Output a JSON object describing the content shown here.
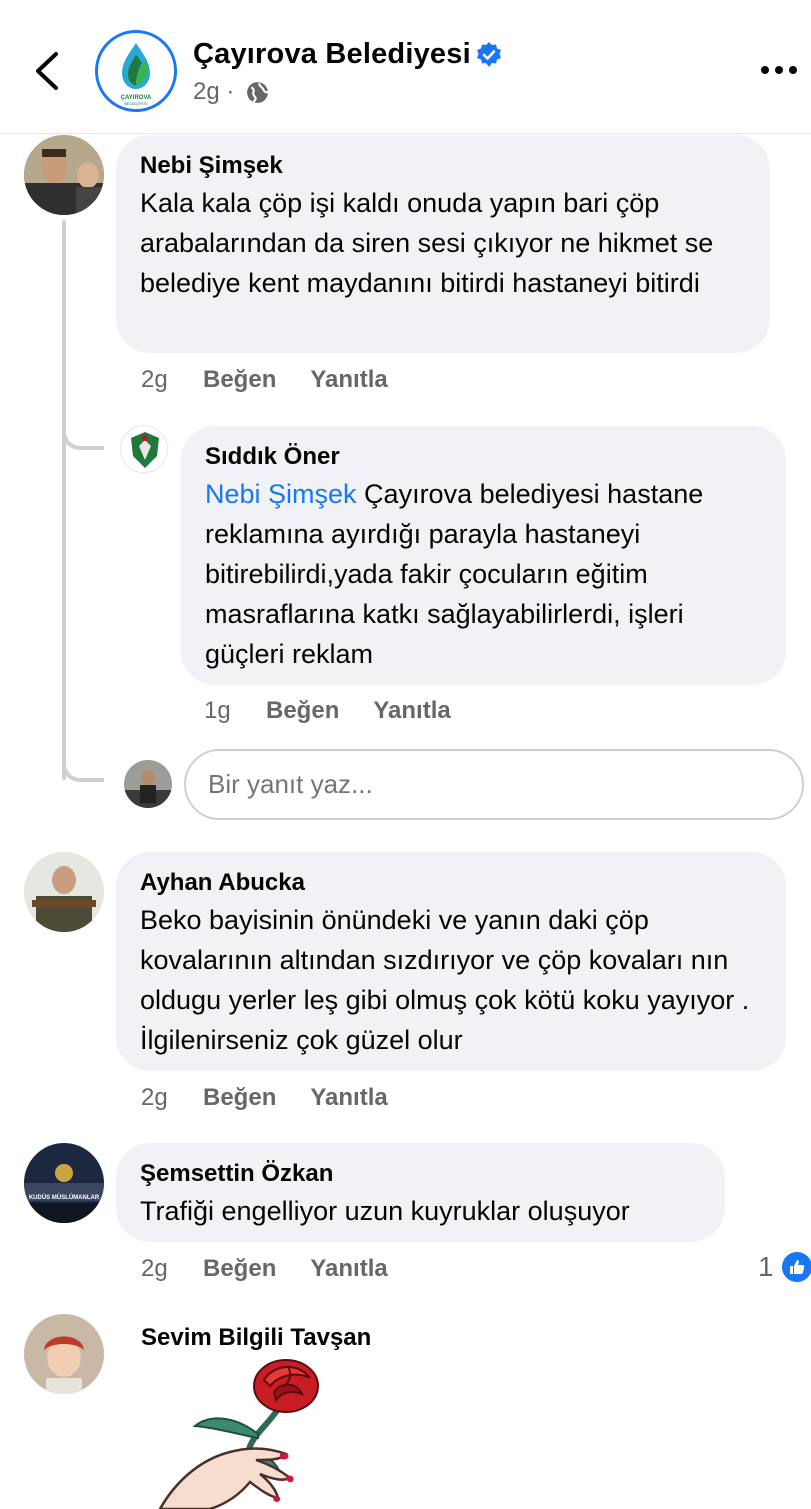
{
  "header": {
    "page_name": "Çayırova Belediyesi",
    "post_time": "2g",
    "separator": "·",
    "logo_text": "ÇAYIROVA",
    "logo_subtext": "BELEDİYESİ"
  },
  "colors": {
    "accent": "#1877f2",
    "bubble": "#f0f2f5",
    "secondary_text": "#65676b"
  },
  "comments": [
    {
      "author": "Nebi Şimşek",
      "text": "Kala kala çöp işi kaldı onuda yapın bari çöp arabalarından da siren sesi çıkıyor ne hikmet se belediye kent maydanını bitirdi hastaneyi bitirdi",
      "time": "2g",
      "like_label": "Beğen",
      "reply_label": "Yanıtla",
      "replies": [
        {
          "author": "Sıddık Öner",
          "mention": "Nebi Şimşek",
          "text": " Çayırova belediyesi hastane reklamına ayırdığı parayla hastaneyi bitirebilirdi,yada fakir çocuların eğitim masraflarına katkı sağlayabilirlerdi, işleri güçleri reklam",
          "time": "1g",
          "like_label": "Beğen",
          "reply_label": "Yanıtla"
        }
      ],
      "reply_placeholder": "Bir yanıt yaz..."
    },
    {
      "author": "Ayhan Abucka",
      "text": "Beko bayisinin önündeki ve yanın daki çöp kovalarının altından sızdırıyor ve çöp kovaları nın oldugu yerler leş gibi olmuş çok kötü koku yayıyor . İlgilenirseniz çok güzel olur",
      "time": "2g",
      "like_label": "Beğen",
      "reply_label": "Yanıtla"
    },
    {
      "author": "Şemsettin Özkan",
      "text": "Trafiği engelliyor uzun kuyruklar oluşuyor",
      "time": "2g",
      "like_label": "Beğen",
      "reply_label": "Yanıtla",
      "reaction_count": "1",
      "reaction_icon": "like-icon",
      "avatar_text": "KUDÜS MÜSLÜMANLAR"
    },
    {
      "author": "Sevim Bilgili Tavşan",
      "sticker": "rose-sticker"
    }
  ]
}
